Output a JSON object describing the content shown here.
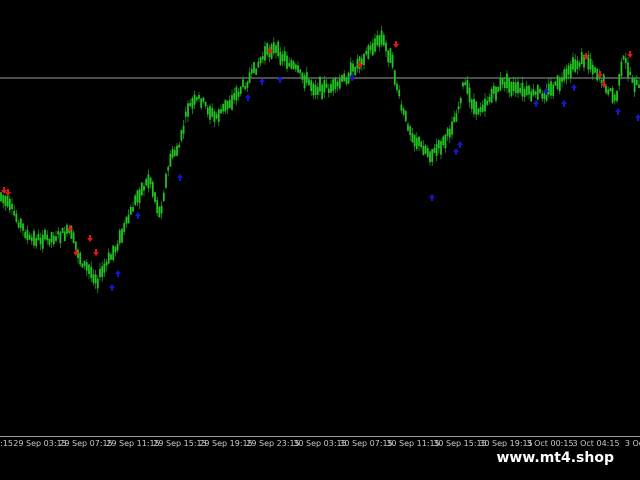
{
  "chart": {
    "background": "#000000",
    "candle_color": "#22c422",
    "buy_arrow_color": "#1414d2",
    "sell_arrow_color": "#e01818",
    "horizontal_line_color": "#9a9a9a"
  },
  "time_axis": {
    "labels": [
      "3:15",
      "29 Sep 03:15",
      "29 Sep 07:15",
      "29 Sep 11:15",
      "29 Sep 15:15",
      "29 Sep 19:15",
      "29 Sep 23:15",
      "30 Sep 03:15",
      "30 Sep 07:15",
      "30 Sep 11:15",
      "30 Sep 15:15",
      "30 Sep 19:15",
      "3 Oct 00:15",
      "3 Oct 04:15",
      "3 Oc"
    ]
  },
  "watermark": {
    "text": "www.mt4.shop"
  }
}
